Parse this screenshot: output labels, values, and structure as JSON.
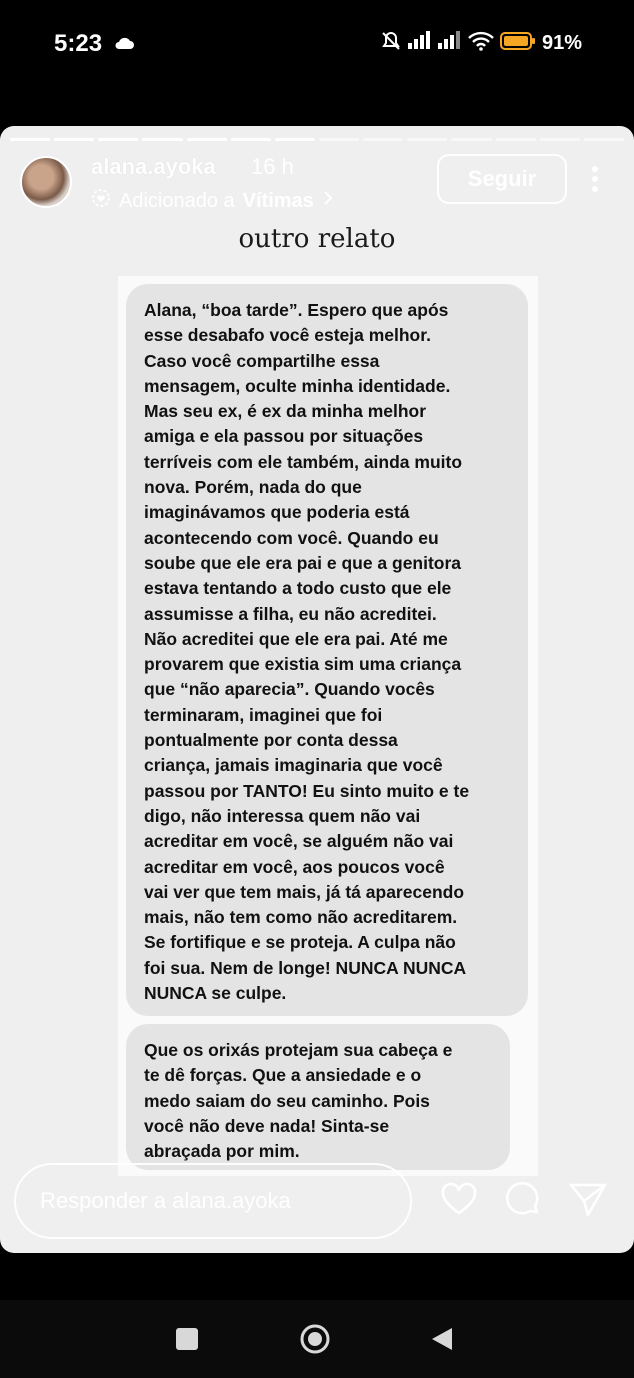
{
  "status_bar": {
    "time": "5:23",
    "battery": "91%"
  },
  "story": {
    "username": "alana.ayoka",
    "time_ago": "16 h",
    "added_prefix": "Adicionado a",
    "added_collection": "Vítimas",
    "follow_label": "Seguir",
    "title": "outro relato",
    "messages": [
      "Alana, “boa tarde”. Espero que após\nesse desabafo você esteja melhor.\nCaso você compartilhe essa\nmensagem, oculte minha identidade.\nMas seu ex, é ex da minha melhor\namiga e ela passou por situações\nterríveis com ele também, ainda muito\nnova. Porém, nada do que\nimaginávamos que poderia está\nacontecendo com você. Quando eu\nsoube que ele era pai e que a genitora\nestava tentando a todo custo que ele\nassumisse a filha, eu não acreditei.\nNão acreditei que ele era pai. Até me\nprovarem que existia sim uma criança\nque “não aparecia”. Quando vocês\nterminaram, imaginei que foi\npontualmente por conta dessa\ncriança, jamais imaginaria que você\npassou por TANTO! Eu sinto muito e te\ndigo, não interessa quem não vai\nacreditar em você, se alguém não vai\nacreditar em você, aos poucos você\nvai ver que tem mais, já tá aparecendo\nmais, não tem como não acreditarem.\nSe fortifique e se proteja. A culpa não\nfoi sua. Nem de longe! NUNCA NUNCA\nNUNCA se culpe.",
      "Que os orixás protejam sua cabeça e\nte dê forças. Que a ansiedade e o\nmedo saiam do seu caminho. Pois\nvocê não deve nada! Sinta-se\nabraçada por mim."
    ],
    "reply_placeholder": "Responder a alana.ayoka"
  },
  "icons": {
    "status": [
      "cloud-icon",
      "mute-icon",
      "signal-icon",
      "wifi-icon",
      "battery-icon"
    ],
    "header": [
      "avatar",
      "highlight-icon",
      "chevron-right-icon",
      "more-icon"
    ],
    "footer": [
      "heart-icon",
      "chat-icon",
      "send-icon"
    ],
    "nav": [
      "recents-icon",
      "home-icon",
      "back-icon"
    ]
  },
  "colors": {
    "story_bg": "#efefef",
    "bubble_bg": "#e4e4e4",
    "battery": "#f5a623"
  }
}
